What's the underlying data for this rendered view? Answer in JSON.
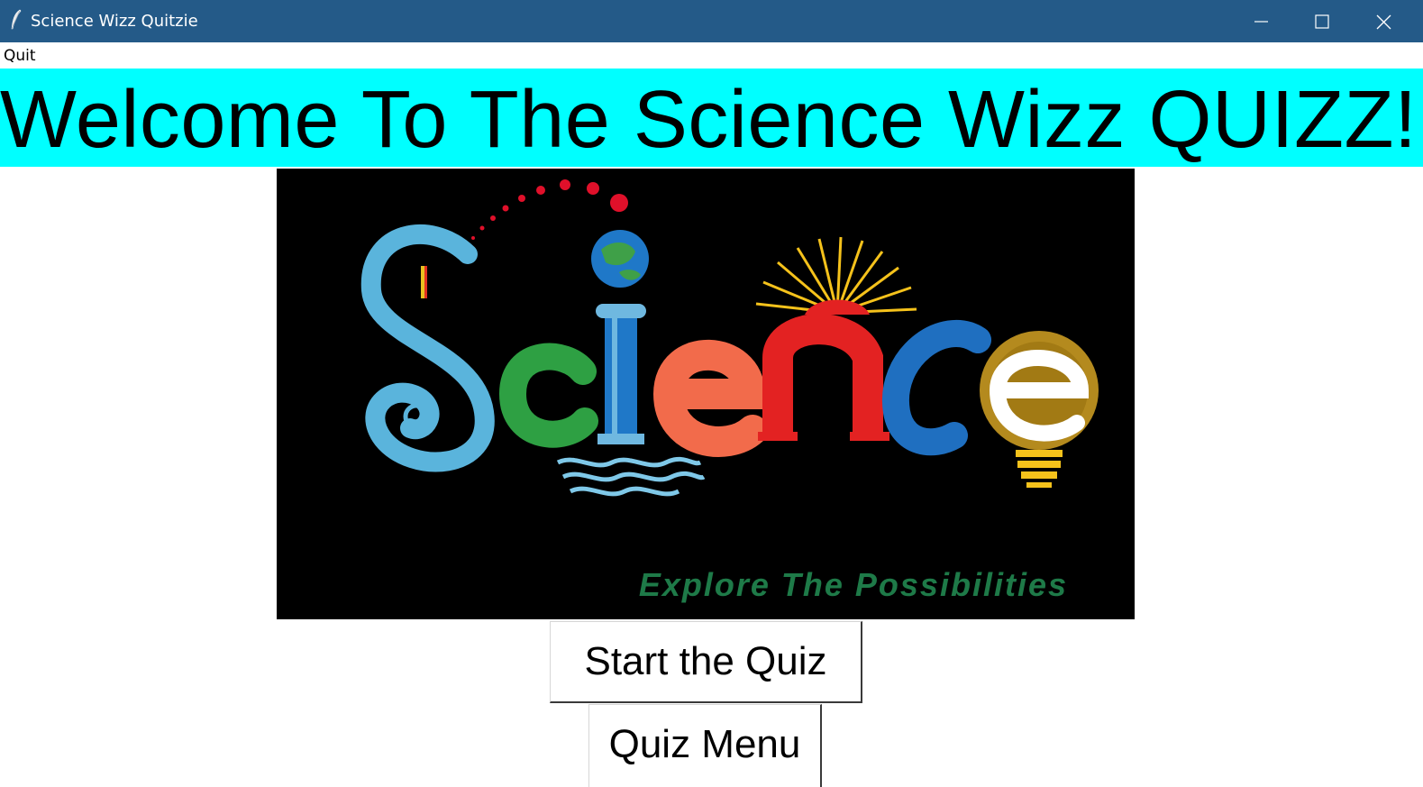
{
  "window": {
    "title": "Science Wizz Quitzie",
    "icon": "feather-icon",
    "titlebar_color": "#245a88",
    "controls": [
      "minimize-icon",
      "maximize-icon",
      "close-icon"
    ]
  },
  "menubar": {
    "items": [
      {
        "label": "Quit"
      }
    ]
  },
  "banner": {
    "text": "Welcome To The Science Wizz QUIZZ!",
    "background": "#00ffff"
  },
  "image": {
    "word": "Science",
    "tagline": "Explore The Possibilities",
    "background": "#000000",
    "letter_colors": [
      "#5ab4dc",
      "#2ea043",
      "#1f78c8",
      "#f26b4b",
      "#e32222",
      "#e32222",
      "#1f6fc0",
      "#ffffff"
    ]
  },
  "buttons": {
    "start_label": "Start the Quiz",
    "menu_label": "Quiz Menu"
  }
}
